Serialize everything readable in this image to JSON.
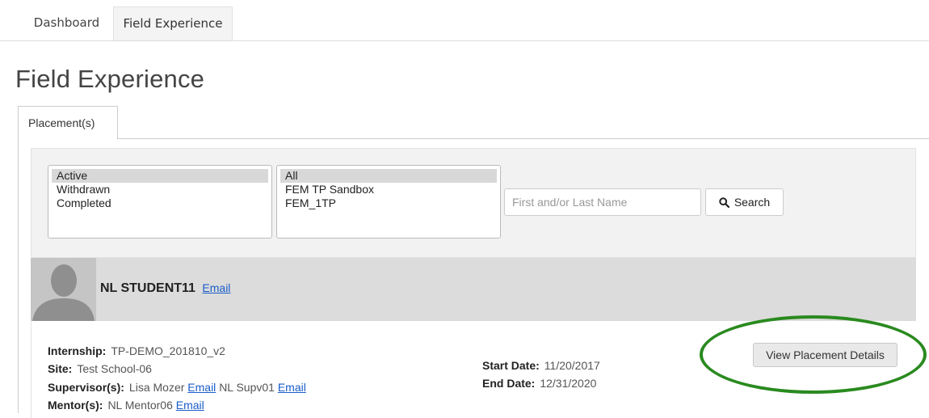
{
  "nav": {
    "tabs": [
      {
        "label": "Dashboard"
      },
      {
        "label": "Field Experience"
      }
    ]
  },
  "page": {
    "title": "Field Experience"
  },
  "placement_tab": {
    "label": "Placement(s)"
  },
  "filters": {
    "status_options": [
      "Active",
      "Withdrawn",
      "Completed"
    ],
    "status_selected": "Active",
    "program_options": [
      "All",
      "FEM TP Sandbox",
      "FEM_1TP"
    ],
    "program_selected": "All",
    "search_placeholder": "First and/or Last Name",
    "search_button": "Search",
    "search_icon": "search-icon"
  },
  "student": {
    "name": "NL STUDENT11",
    "email_link": "Email",
    "avatar_icon": "user-avatar-icon",
    "internship_label": "Internship:",
    "internship_value": "TP-DEMO_201810_v2",
    "site_label": "Site:",
    "site_value": "Test School-06",
    "supervisors_label": "Supervisor(s):",
    "supervisor1": "Lisa Mozer",
    "supervisor1_email": "Email",
    "supervisor2": "NL Supv01",
    "supervisor2_email": "Email",
    "mentors_label": "Mentor(s):",
    "mentor1": "NL Mentor06",
    "mentor1_email": "Email",
    "start_label": "Start Date:",
    "start_value": "11/20/2017",
    "end_label": "End Date:",
    "end_value": "12/31/2020",
    "view_button": "View Placement Details"
  },
  "colors": {
    "highlight": "#2a8a1f",
    "link": "#1a5cc8",
    "header_bg": "#dcdcdc"
  }
}
